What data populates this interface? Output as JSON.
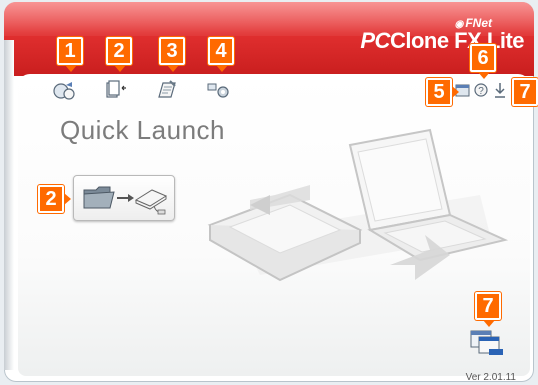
{
  "brand": {
    "fnet": "FNet",
    "product_prefix": "PC",
    "product_name": "Clone FX Lite"
  },
  "toolbar": {
    "left_icons": [
      "backup-icon",
      "restore-icon",
      "schedule-icon",
      "settings-icon"
    ],
    "right_icons": [
      "window-icon",
      "help-icon",
      "minimize-icon"
    ]
  },
  "badges": {
    "b1": "1",
    "b2": "2",
    "b3": "3",
    "b4": "4",
    "b5": "5",
    "b6": "6",
    "b7": "7",
    "b2_quick": "2",
    "b7_corner": "7"
  },
  "main": {
    "title": "Quick Launch"
  },
  "footer": {
    "version": "Ver 2.01.11"
  },
  "colors": {
    "titlebar": "#e23030",
    "badge": "#ff6a00",
    "accent_blue": "#2a63b5"
  }
}
